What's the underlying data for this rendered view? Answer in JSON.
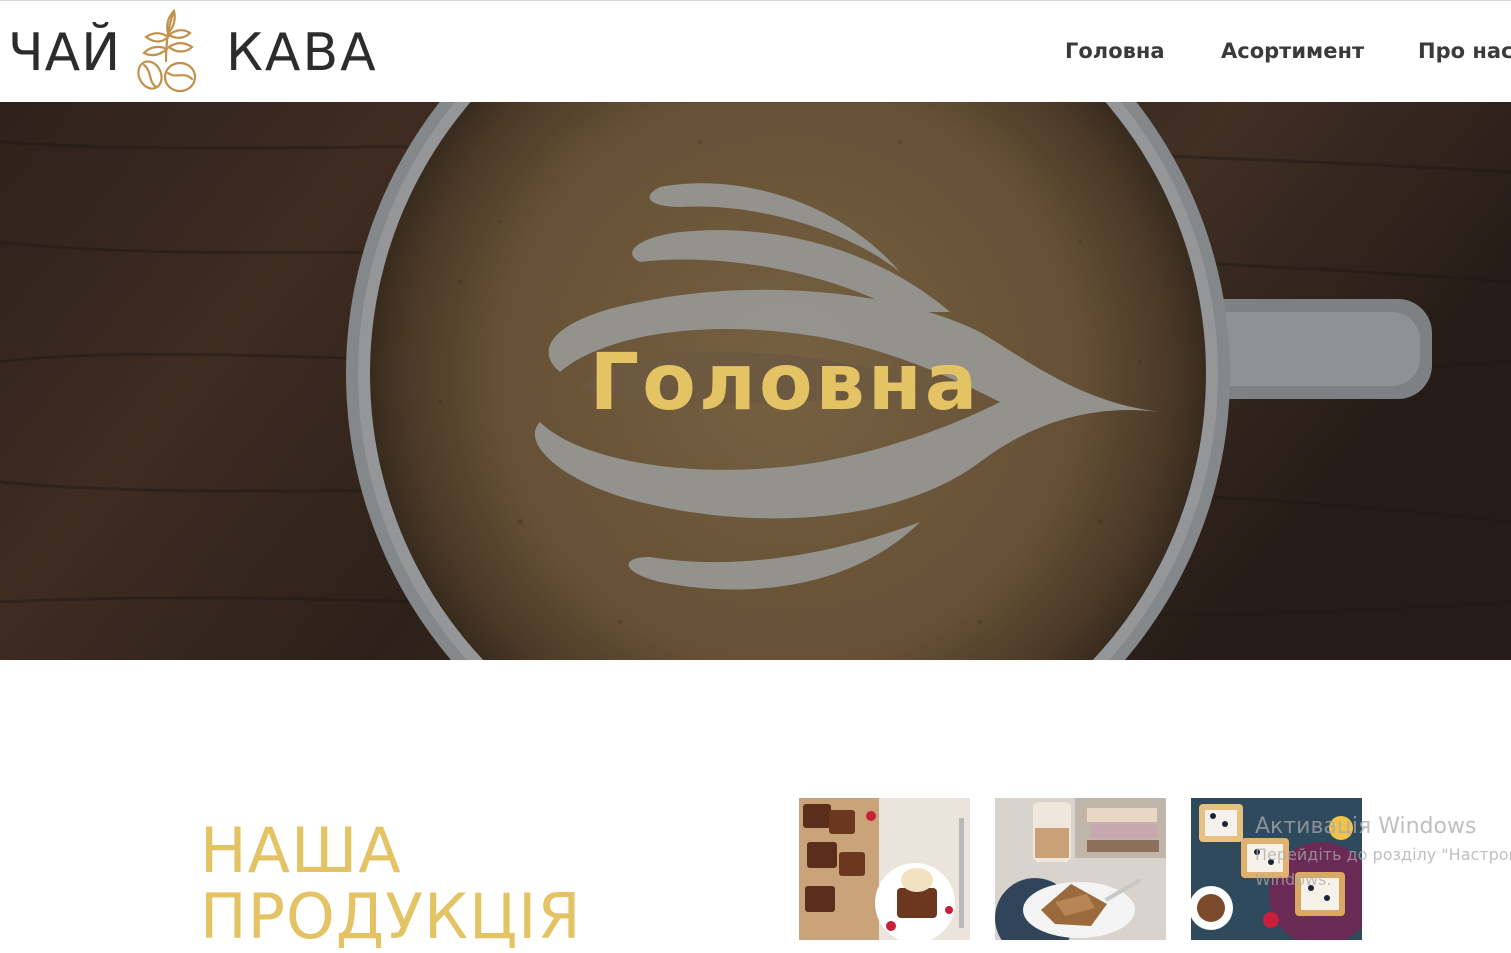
{
  "logo": {
    "left_text": "ЧАЙ",
    "right_text": "КАВА",
    "icon": "leaf-coffee-bean-icon"
  },
  "nav": {
    "items": [
      {
        "label": "Головна"
      },
      {
        "label": "Асортимент"
      },
      {
        "label": "Про нас"
      }
    ]
  },
  "hero": {
    "title": "Головна",
    "image": "latte-art-cup-photo"
  },
  "products": {
    "heading_line1": "НАША",
    "heading_line2": "ПРОДУКЦІЯ",
    "thumbnails": [
      {
        "image": "brownies-and-ice-cream-photo"
      },
      {
        "image": "latte-and-cake-photo"
      },
      {
        "image": "waffles-with-berries-photo"
      }
    ]
  },
  "watermark": {
    "title": "Активація Windows",
    "subtitle": "Перейдіть до розділу \"Настрой",
    "subtitle2": "Windows."
  },
  "colors": {
    "accent": "#e3c364",
    "text": "#2c2c2c",
    "logo_gold": "#c1914a"
  }
}
